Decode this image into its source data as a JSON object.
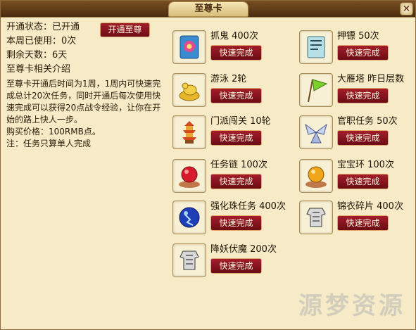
{
  "window": {
    "title": "至尊卡",
    "close_label": "×"
  },
  "status": {
    "open_state_label": "开通状态：",
    "open_state_value": "已开通",
    "open_button": "开通至尊",
    "used_label": "本周已使用：",
    "used_value": "0次",
    "remaining_label": "剩余天数：",
    "remaining_value": "6天",
    "intro_heading": "至尊卡相关介绍"
  },
  "description": {
    "text": "至尊卡开通后时间为1周，1周内可快速完成总计20次任务，同时开通后每次使用快速完成可以获得20点战令经验，让你在开始的路上快人一步。",
    "price": "购买价格：100RMB点。",
    "note": "注：任务只算单人完成"
  },
  "items": [
    {
      "name": "抓鬼  400次",
      "button": "快速完成",
      "icon": "ghost-scroll-icon"
    },
    {
      "name": "押镖  50次",
      "button": "快速完成",
      "icon": "escort-book-icon"
    },
    {
      "name": "游泳  2轮",
      "button": "快速完成",
      "icon": "duck-gold-icon"
    },
    {
      "name": "大雁塔  昨日层数",
      "button": "快速完成",
      "icon": "green-flag-icon"
    },
    {
      "name": "门派闯关  10轮",
      "button": "快速完成",
      "icon": "pagoda-icon"
    },
    {
      "name": "官职任务  50次",
      "button": "快速完成",
      "icon": "silver-wings-icon"
    },
    {
      "name": "任务链  100次",
      "button": "快速完成",
      "icon": "red-orb-icon"
    },
    {
      "name": "宝宝环  100次",
      "button": "快速完成",
      "icon": "gold-orb-icon"
    },
    {
      "name": "强化珠任务  400次",
      "button": "快速完成",
      "icon": "blue-orb-icon"
    },
    {
      "name": "锦衣碎片  400次",
      "button": "快速完成",
      "icon": "armor-fragment-icon"
    },
    {
      "name": "降妖伏魔  200次",
      "button": "快速完成",
      "icon": "armor-fragment-icon"
    }
  ],
  "watermark": "源梦资源",
  "colors": {
    "button_red": "#8a1620",
    "panel_bg": "#f6ebc6",
    "title_bar": "#5a3612"
  }
}
